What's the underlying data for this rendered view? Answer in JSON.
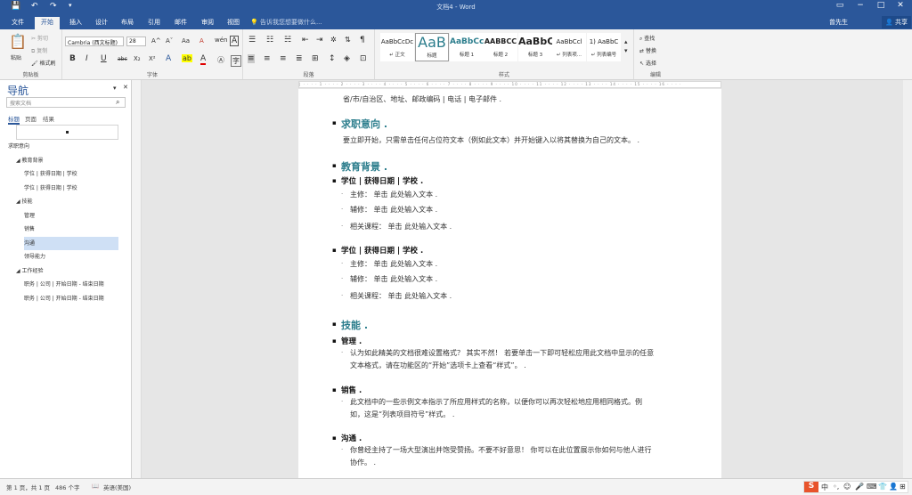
{
  "titlebar": {
    "title": "文档4 - Word",
    "save_icon": "save-icon",
    "undo_icon": "undo-icon",
    "redo_icon": "redo-icon",
    "customize_icon": "customize-icon"
  },
  "tabs": [
    "文件",
    "开始",
    "插入",
    "设计",
    "布局",
    "引用",
    "邮件",
    "审阅",
    "视图"
  ],
  "tellme": "告诉我您想要做什么...",
  "user": "曾先生",
  "share": "共享",
  "ribbon": {
    "clipboard": {
      "label": "剪贴板",
      "paste": "粘贴",
      "cut": "剪切",
      "copy": "复制",
      "format_painter": "格式刷"
    },
    "font": {
      "label": "字体",
      "font_name": "Cambria (西文标题)",
      "font_size": "28",
      "bold": "B",
      "italic": "I",
      "underline": "U",
      "strike": "abc",
      "sub": "X₂",
      "sup": "X²",
      "grow": "A^",
      "shrink": "Aˇ",
      "case": "Aa",
      "clear": "A",
      "color": "A",
      "highlight": "ab"
    },
    "paragraph": {
      "label": "段落"
    },
    "styles": {
      "label": "样式",
      "items": [
        {
          "preview": "AaBbCcDc",
          "name": "↵ 正文"
        },
        {
          "preview": "AaB",
          "name": "标题"
        },
        {
          "preview": "AaBbCc",
          "name": "标题 1"
        },
        {
          "preview": "AABBCC",
          "name": "标题 2"
        },
        {
          "preview": "AaBbC",
          "name": "标题 3"
        },
        {
          "preview": "AaBbCcl",
          "name": "↵ 列表项..."
        },
        {
          "preview": "1) AaBbC",
          "name": "↵ 列表编号"
        }
      ]
    },
    "editing": {
      "label": "编辑",
      "find": "查找",
      "replace": "替换",
      "select": "选择"
    }
  },
  "nav": {
    "title": "导航",
    "search_placeholder": "搜索文档",
    "tabs": [
      "标题",
      "页面",
      "结果"
    ],
    "top_item": "▪",
    "items": [
      {
        "text": "求职意向",
        "level": 1,
        "selected": false
      },
      {
        "text": "◢ 教育背景",
        "level": 0,
        "selected": false
      },
      {
        "text": "学位 | 获得日期 | 学校",
        "level": 2,
        "selected": false
      },
      {
        "text": "学位 | 获得日期 | 学校",
        "level": 2,
        "selected": false
      },
      {
        "text": "◢ 技能",
        "level": 0,
        "selected": false
      },
      {
        "text": "管理",
        "level": 2,
        "selected": false
      },
      {
        "text": "销售",
        "level": 2,
        "selected": false
      },
      {
        "text": "沟通",
        "level": 2,
        "selected": true
      },
      {
        "text": "领导能力",
        "level": 2,
        "selected": false
      },
      {
        "text": "◢ 工作经验",
        "level": 0,
        "selected": false
      },
      {
        "text": "职务 | 公司 | 开始日期 - 结束日期",
        "level": 2,
        "selected": false
      },
      {
        "text": "职务 | 公司 | 开始日期 - 结束日期",
        "level": 2,
        "selected": false
      }
    ]
  },
  "document": {
    "address": "省/市/自治区、地址、邮政编码 | 电话 | 电子邮件 .",
    "h_objective": "求职意向 .",
    "objective": "要立即开始，只需单击任何占位符文本（例如此文本）并开始键入以将其替换为自己的文本。 .",
    "h_edu": "教育背景 .",
    "edu1": "学位 | 获得日期 | 学校 .",
    "major": "主修： 单击 此处输入文本 .",
    "minor": "辅修： 单击 此处输入文本 .",
    "course": "相关课程： 单击 此处输入文本 .",
    "edu2": "学位 | 获得日期 | 学校 .",
    "h_skills": "技能 .",
    "mgmt": "管理 .",
    "mgmt_b1": "认为如此精美的文档很难设置格式？ 其实不然！ 若要单击一下即可轻松应用此文档中显示的任意",
    "mgmt_b2": "文本格式，请在功能区的“开始”选项卡上查看“样式”。 .",
    "sales": "销售 .",
    "sales_b1": "此文档中的一些示例文本指示了所应用样式的名称，以便你可以再次轻松地应用相同格式。例",
    "sales_b2": "如，这是“列表项目符号”样式。 .",
    "comm": "沟通 .",
    "comm_b1": "你曾经主持了一场大型演出并饱受赞扬。不要不好意思！ 你可以在此位置展示你如何与他人进行",
    "comm_b2": "协作。 ."
  },
  "status": {
    "page": "第 1 页，共 1 页",
    "words": "486 个字",
    "lang": "英语(美国)"
  },
  "ime": {
    "logo": "S",
    "items": [
      "中",
      "◦,",
      "☺",
      "🎤",
      "⌨",
      "👕",
      "👤",
      "⊞"
    ]
  }
}
